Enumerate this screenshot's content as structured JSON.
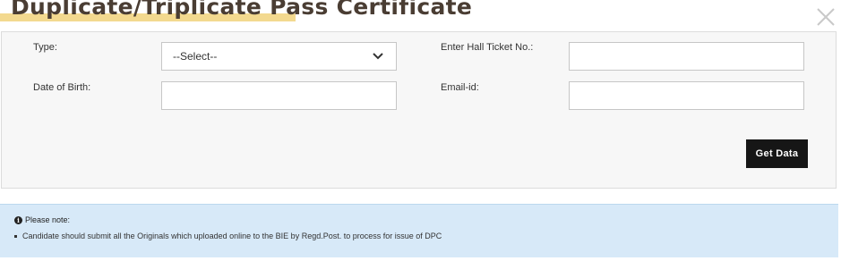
{
  "modal": {
    "title": "Duplicate/Triplicate Pass Certificate",
    "close_icon": "close-icon"
  },
  "form": {
    "type_label": "Type:",
    "type_selected": "--Select--",
    "hall_ticket_label": "Enter Hall Ticket No.:",
    "hall_ticket_value": "",
    "dob_label": "Date of Birth:",
    "dob_value": "",
    "email_label": "Email-id:",
    "email_value": "",
    "submit_label": "Get Data"
  },
  "note": {
    "heading_icon": "info-icon",
    "heading": "Please note:",
    "items": [
      "Candidate should submit all the Originals which uploaded online to the BIE by Regd.Post. to process for issue of DPC"
    ]
  },
  "colors": {
    "title_text": "#4a3d33",
    "title_highlight": "#f3d98f",
    "button_bg": "#161616",
    "note_bg": "#d7e9f8"
  }
}
